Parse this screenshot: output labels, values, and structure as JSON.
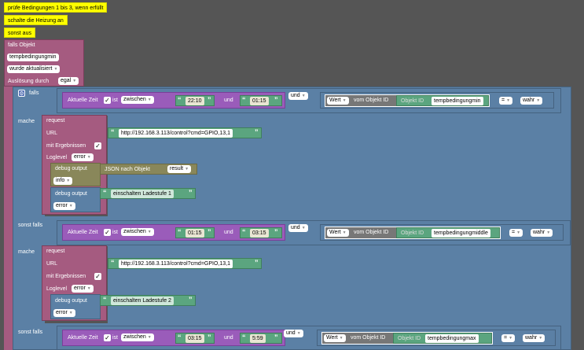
{
  "comments": {
    "c1": "prüfe Bedingungen 1 bis 3, wenn erfüllt",
    "c2": "schalte die Heizung an",
    "c3": "sonst aus"
  },
  "trigger": {
    "falls_objekt": "falls Objekt",
    "object_name": "tempbedingungmin",
    "wurde": "wurde aktualisiert",
    "ausloesung_label": "Auslösung durch",
    "ausloesung_value": "egal"
  },
  "labels": {
    "falls": "falls",
    "mache": "mache",
    "sonst_falls": "sonst falls",
    "aktuelle_zeit": "Aktuelle Zeit",
    "ist": "ist",
    "und": "und",
    "wert": "Wert",
    "vom_objekt_id": "vom Objekt ID",
    "objekt_id": "Objekt ID",
    "request": "request",
    "url": "URL",
    "mit_ergebnissen": "mit Ergebnissen",
    "loglevel": "Loglevel",
    "debug_output": "debug output",
    "json_nach_objekt": "JSON nach Objekt",
    "result": "result",
    "check": "✓",
    "quote_open": "“",
    "quote_close": "”"
  },
  "conditions": [
    {
      "op": "zwischen",
      "t1": "22:10",
      "t2": "01:15",
      "logic": "und",
      "object": "tempbedingungmin",
      "cmp": "=",
      "val": "wahr"
    },
    {
      "op": "zwischen",
      "t1": "01:15",
      "t2": "03:15",
      "logic": "und",
      "object": "tempbedingungmiddle",
      "cmp": "=",
      "val": "wahr"
    },
    {
      "op": "zwischen",
      "t1": "03:15",
      "t2": "5:59",
      "logic": "und",
      "object": "tempbedingungmax",
      "cmp": "=",
      "val": "wahr"
    }
  ],
  "requests": [
    {
      "url": "http://192.168.3.113/control?cmd=GPIO,13,1",
      "loglevel": "error",
      "debug1_level": "info",
      "debug2_text": "einschalten Ladestufe 1",
      "debug2_level": "error"
    },
    {
      "url": "http://192.168.3.113/control?cmd=GPIO,13,1",
      "loglevel": "error",
      "debug_text": "einschalten Ladestufe 2",
      "debug_level": "error"
    }
  ],
  "colors": {
    "workspace": "#555555",
    "comment": "#ffff00",
    "event": "#a55b80",
    "logic": "#5b80a5",
    "time": "#9a5cba",
    "debug": "#5ba57f",
    "json": "#89875a"
  }
}
